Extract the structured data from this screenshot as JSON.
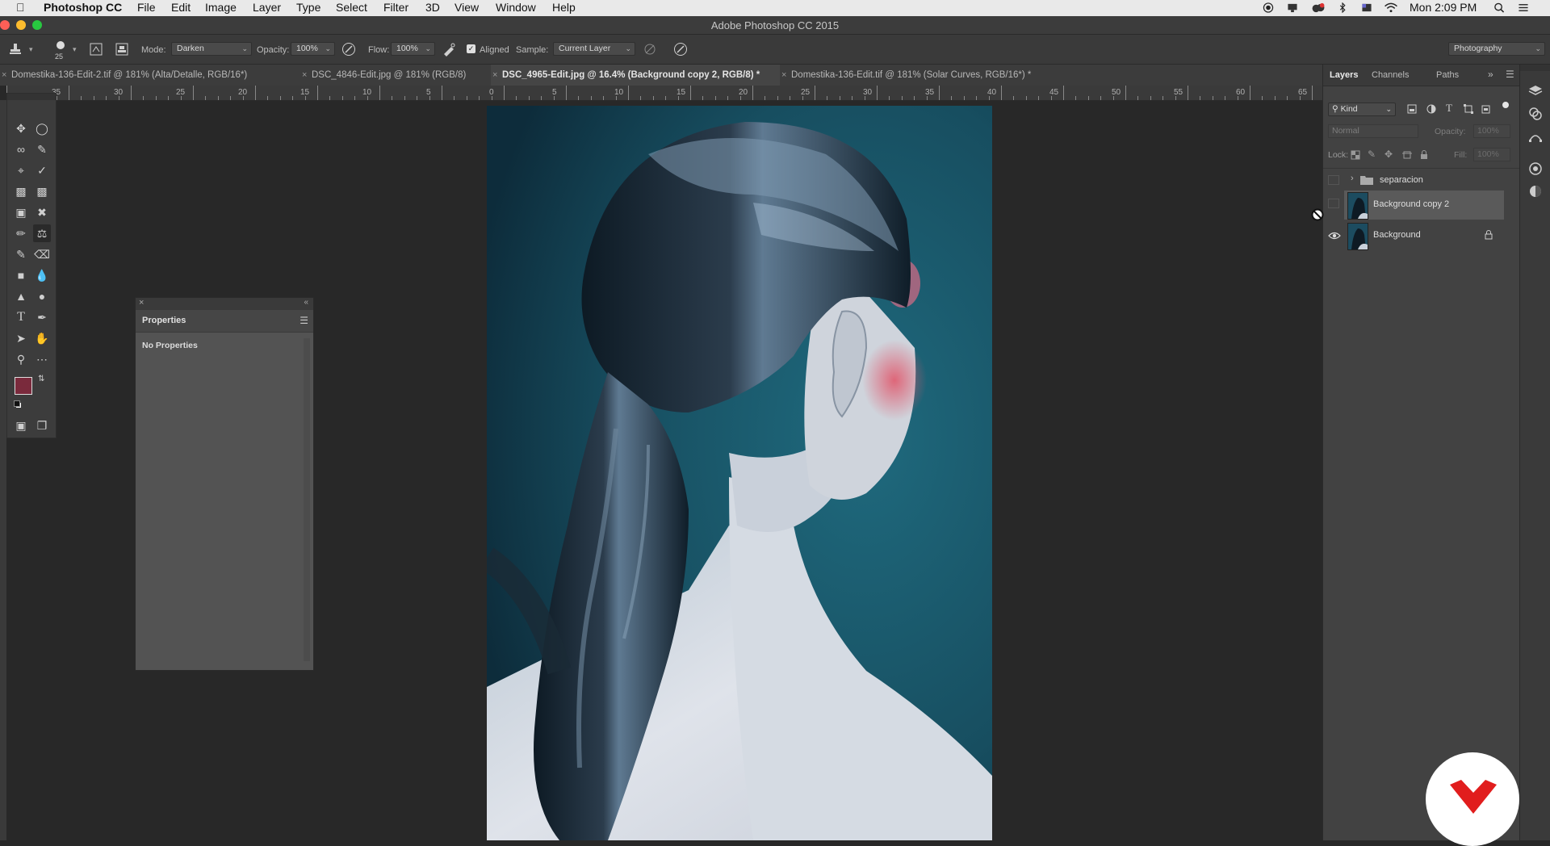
{
  "menubar": {
    "app_name": "Photoshop CC",
    "items": [
      "File",
      "Edit",
      "Image",
      "Layer",
      "Type",
      "Select",
      "Filter",
      "3D",
      "View",
      "Window",
      "Help"
    ],
    "clock": "Mon 2:09 PM"
  },
  "window": {
    "title": "Adobe Photoshop CC 2015"
  },
  "options": {
    "brush_size": "25",
    "mode_label": "Mode:",
    "mode_value": "Darken",
    "opacity_label": "Opacity:",
    "opacity_value": "100%",
    "flow_label": "Flow:",
    "flow_value": "100%",
    "aligned_label": "Aligned",
    "aligned_checked": true,
    "sample_label": "Sample:",
    "sample_value": "Current Layer",
    "workspace": "Photography"
  },
  "tabs": [
    {
      "label": "Domestika-136-Edit-2.tif @ 181% (Alta/Detalle, RGB/16*)",
      "active": false
    },
    {
      "label": "DSC_4846-Edit.jpg @ 181% (RGB/8)",
      "active": false
    },
    {
      "label": "DSC_4965-Edit.jpg @ 16.4% (Background copy 2, RGB/8) *",
      "active": true
    },
    {
      "label": "Domestika-136-Edit.tif @ 181% (Solar Curves, RGB/16*) *",
      "active": false
    }
  ],
  "ruler": {
    "labels": [
      "35",
      "30",
      "25",
      "20",
      "15",
      "10",
      "5",
      "0",
      "5",
      "10",
      "15",
      "20",
      "25",
      "30",
      "35",
      "40",
      "45",
      "50",
      "55",
      "60",
      "65"
    ]
  },
  "colors": {
    "foreground": "#7a2a3c",
    "background": "#f2f2f2",
    "panel": "#424242",
    "selected_layer": "#5a5a5a"
  },
  "properties": {
    "title": "Properties",
    "body": "No Properties"
  },
  "layers_panel": {
    "tabs": [
      "Layers",
      "Channels",
      "Paths"
    ],
    "filter_kind": "Kind",
    "blend_mode": "Normal",
    "opacity_label": "Opacity:",
    "opacity_value": "100%",
    "lock_label": "Lock:",
    "fill_label": "Fill:",
    "fill_value": "100%",
    "layers": [
      {
        "name": "separacion",
        "type": "group",
        "visible": false,
        "selected": false,
        "locked": false
      },
      {
        "name": "Background copy 2",
        "type": "pixel",
        "visible": false,
        "selected": true,
        "locked": false
      },
      {
        "name": "Background",
        "type": "pixel",
        "visible": true,
        "selected": false,
        "locked": true
      }
    ]
  },
  "icons": {
    "tools": [
      "move-icon",
      "marquee-ellipse-icon",
      "lasso-icon",
      "quick-select-icon",
      "crop-icon",
      "eyedropper-icon",
      "healing-icon",
      "patch-icon",
      "content-aware-icon",
      "shuffle-icon",
      "brush-icon",
      "clone-stamp-icon",
      "history-brush-icon",
      "eraser-icon",
      "gradient-icon",
      "blur-icon",
      "sharpen-icon",
      "dodge-icon",
      "type-icon",
      "pen-icon",
      "path-select-icon",
      "hand-icon",
      "zoom-icon",
      "more-icon",
      "quick-mask-icon",
      "screen-mode-icon"
    ]
  }
}
